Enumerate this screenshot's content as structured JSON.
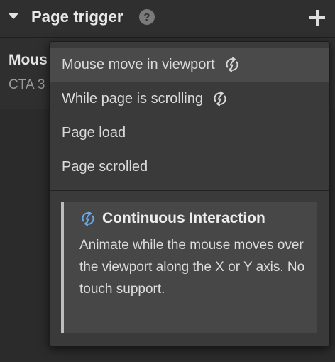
{
  "header": {
    "title": "Page trigger",
    "help_glyph": "?",
    "icons": [
      "caret-down-icon",
      "help-icon",
      "plus-icon"
    ]
  },
  "trigger_row": {
    "name": "Mous",
    "subtitle": "CTA 3"
  },
  "dropdown": {
    "items": [
      {
        "label": "Mouse move in viewport",
        "continuous": true,
        "active": true
      },
      {
        "label": "While page is scrolling",
        "continuous": true,
        "active": false
      },
      {
        "label": "Page load",
        "continuous": false,
        "active": false
      },
      {
        "label": "Page scrolled",
        "continuous": false,
        "active": false
      }
    ],
    "info": {
      "title": "Continuous Interaction",
      "body": "Animate while the mouse moves over the viewport along the X or Y axis. No touch support."
    }
  },
  "colors": {
    "panel_bg": "#2b2b2b",
    "dropdown_bg": "#3a3a3a",
    "active_item_bg": "#4a4a4a",
    "info_bg": "#474747",
    "info_icon": "#6aa9e8"
  }
}
